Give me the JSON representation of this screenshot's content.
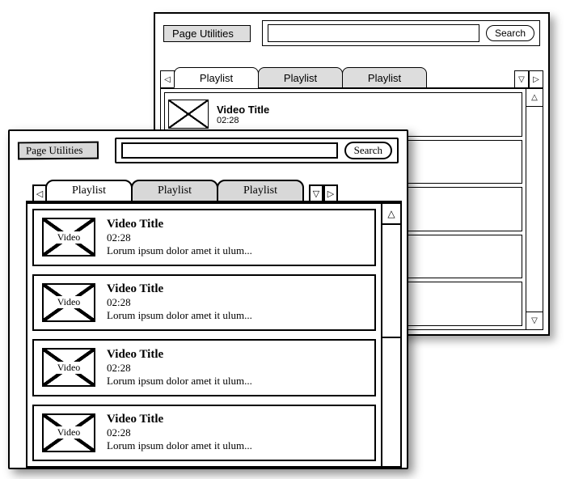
{
  "back": {
    "utilities_label": "Page Utilities",
    "search_placeholder": "",
    "search_button": "Search",
    "tabs": [
      "Playlist",
      "Playlist",
      "Playlist"
    ],
    "first_item": {
      "title": "Video Title",
      "duration": "02:28"
    }
  },
  "front": {
    "utilities_label": "Page Utilities",
    "search_placeholder": "",
    "search_button": "Search",
    "tabs": [
      "Playlist",
      "Playlist",
      "Playlist"
    ],
    "thumb_label": "Video",
    "items": [
      {
        "title": "Video Title",
        "duration": "02:28",
        "desc": "Lorum ipsum dolor amet it ulum..."
      },
      {
        "title": "Video Title",
        "duration": "02:28",
        "desc": "Lorum ipsum dolor amet it ulum..."
      },
      {
        "title": "Video Title",
        "duration": "02:28",
        "desc": "Lorum ipsum dolor amet it ulum..."
      },
      {
        "title": "Video Title",
        "duration": "02:28",
        "desc": "Lorum ipsum dolor amet it ulum..."
      }
    ]
  }
}
